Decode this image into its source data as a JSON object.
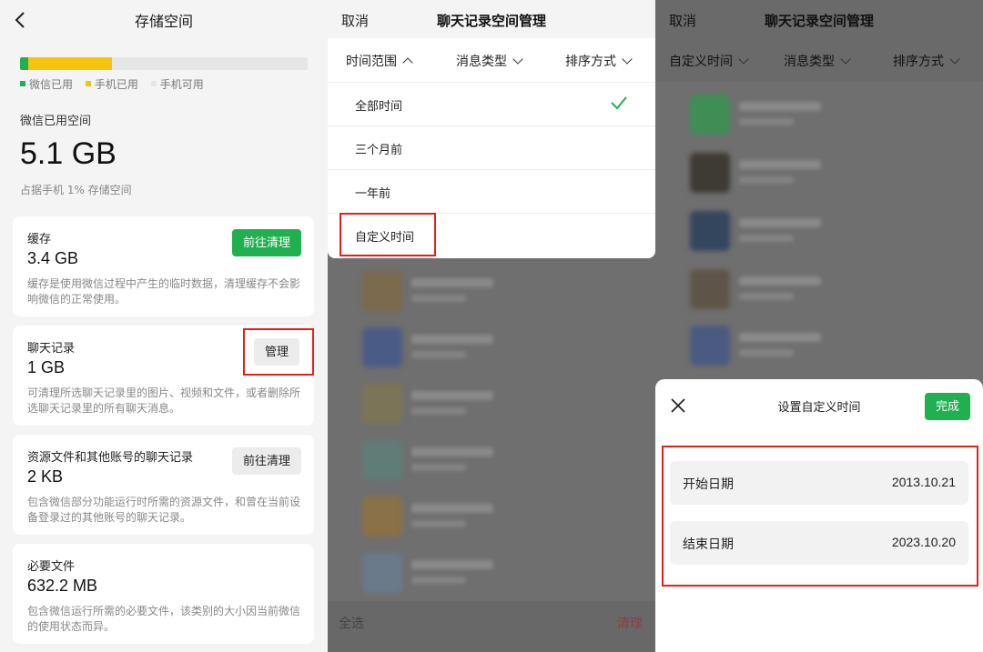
{
  "storage": {
    "title": "存储空间",
    "bar": {
      "wechat_fraction": 0.03,
      "phone_fraction": 0.32
    },
    "legend": {
      "wechat": "微信已用",
      "phone": "手机已用",
      "free": "手机可用"
    },
    "used_label": "微信已用空间",
    "used_value": "5.1 GB",
    "used_sub": "占据手机 1% 存储空间",
    "cards": [
      {
        "title": "缓存",
        "size": "3.4 GB",
        "button": "前往清理",
        "desc": "缓存是使用微信过程中产生的临时数据，清理缓存不会影响微信的正常使用。"
      },
      {
        "title": "聊天记录",
        "size": "1 GB",
        "button": "管理",
        "desc": "可清理所选聊天记录里的图片、视频和文件，或者删除所选聊天记录里的所有聊天消息。"
      },
      {
        "title": "资源文件和其他账号的聊天记录",
        "size": "2 KB",
        "button": "前往清理",
        "desc": "包含微信部分功能运行时所需的资源文件，和曾在当前设备登录过的其他账号的聊天记录。"
      },
      {
        "title": "必要文件",
        "size": "632.2 MB",
        "desc": "包含微信运行所需的必要文件，该类别的大小因当前微信的使用状态而异。"
      }
    ]
  },
  "chat_manage": {
    "cancel": "取消",
    "title": "聊天记录空间管理",
    "filters": [
      "时间范围",
      "消息类型",
      "排序方式"
    ],
    "time_options": [
      "全部时间",
      "三个月前",
      "一年前",
      "自定义时间"
    ],
    "selected_index": 0,
    "bottom_left": "全选",
    "bottom_right": "清理"
  },
  "custom_time": {
    "cancel": "取消",
    "title": "聊天记录空间管理",
    "filters": [
      "自定义时间",
      "消息类型",
      "排序方式"
    ],
    "sheet_title": "设置自定义时间",
    "done": "完成",
    "start_label": "开始日期",
    "start_value": "2013.10.21",
    "end_label": "结束日期",
    "end_value": "2023.10.20"
  },
  "colors": {
    "accent": "#21b04f",
    "phone": "#f5c40d",
    "highlight": "#e2201a"
  },
  "icons": {
    "back": "chevron-left-icon",
    "check": "check-icon",
    "close": "close-icon",
    "dropdown": "chevron-down-icon"
  }
}
